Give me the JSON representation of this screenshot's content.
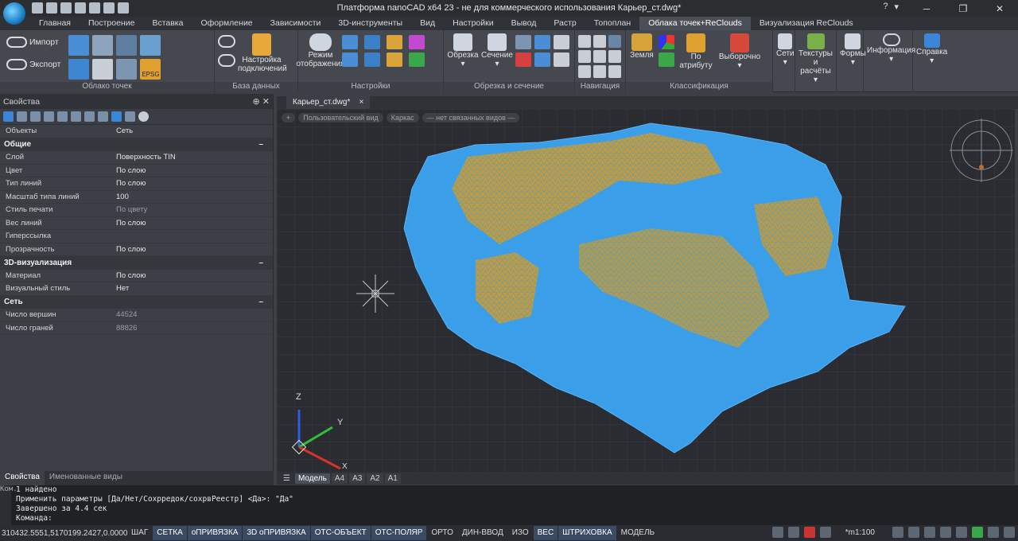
{
  "app": {
    "title": "Платформа nanoCAD x64 23 - не для коммерческого использования Карьер_ст.dwg*",
    "help": "?"
  },
  "tabs": [
    "Главная",
    "Построение",
    "Вставка",
    "Оформление",
    "Зависимости",
    "3D-инструменты",
    "Вид",
    "Настройки",
    "Вывод",
    "Растр",
    "Топоплан",
    "Облака точек+ReClouds",
    "Визуализация ReClouds"
  ],
  "active_tab": "Облака точек+ReClouds",
  "ribbon": {
    "import": "Импорт",
    "export": "Экспорт",
    "epsg": "EPSG",
    "cloud_group": "Облако точек",
    "db_group": "База данных",
    "db_settings": "Настройка подключений",
    "display_mode": "Режим отображения",
    "settings_group": "Настройки",
    "clip": "Обрезка",
    "section": "Сечение",
    "clip_group": "Обрезка и сечение",
    "nav_group": "Навигация",
    "ground": "Земля",
    "by_attr": "По атрибуту",
    "selective": "Выборочно",
    "class_group": "Классификация",
    "nets": "Сети",
    "textures": "Текстуры и расчёты",
    "forms": "Формы",
    "info": "Информация",
    "help": "Справка"
  },
  "panel": {
    "title": "Свойства",
    "rows_top": [
      {
        "k": "Объекты",
        "v": "Сеть"
      }
    ],
    "sec_general": "Общие",
    "general": [
      {
        "k": "Слой",
        "v": "Поверхность TIN"
      },
      {
        "k": "Цвет",
        "v": "По слою"
      },
      {
        "k": "Тип линий",
        "v": "По слою"
      },
      {
        "k": "Масштаб типа линий",
        "v": "100"
      },
      {
        "k": "Стиль печати",
        "v": "По цвету"
      },
      {
        "k": "Вес линий",
        "v": "По слою"
      },
      {
        "k": "Гиперссылка",
        "v": ""
      },
      {
        "k": "Прозрачность",
        "v": "По слою"
      }
    ],
    "sec_3d": "3D-визуализация",
    "vis": [
      {
        "k": "Материал",
        "v": "По слою"
      },
      {
        "k": "Визуальный стиль",
        "v": "Нет"
      }
    ],
    "sec_mesh": "Сеть",
    "mesh": [
      {
        "k": "Число вершин",
        "v": "44524"
      },
      {
        "k": "Число граней",
        "v": "88826"
      }
    ],
    "bottom_tabs": [
      "Свойства",
      "Именованные виды"
    ]
  },
  "doc": {
    "tab": "Карьер_ст.dwg*",
    "close": "×"
  },
  "viewport": {
    "bar": [
      "+",
      "Пользовательский вид",
      "Каркас",
      "— нет связанных видов —"
    ],
    "axis_x": "X",
    "axis_y": "Y",
    "axis_z": "Z"
  },
  "layouts": [
    "Модель",
    "A4",
    "A3",
    "A2",
    "A1"
  ],
  "cmd": {
    "side": "Ком.",
    "lines": [
      "1 найдено",
      "Применить параметры [Да/Нет/Сохрредок/сохрвРеестр] <Да>: \"Да\"",
      "Завершено за 4.4 сек",
      "Команда:"
    ]
  },
  "status": {
    "coords": "310432.5551,5170199.2427,0.0000",
    "buttons": [
      {
        "t": "ШАГ",
        "on": false
      },
      {
        "t": "СЕТКА",
        "on": true
      },
      {
        "t": "оПРИВЯЗКА",
        "on": true
      },
      {
        "t": "3D оПРИВЯЗКА",
        "on": true
      },
      {
        "t": "ОТС-ОБЪЕКТ",
        "on": true
      },
      {
        "t": "ОТС-ПОЛЯР",
        "on": true
      },
      {
        "t": "ОРТО",
        "on": false
      },
      {
        "t": "ДИН-ВВОД",
        "on": false
      },
      {
        "t": "ИЗО",
        "on": false
      },
      {
        "t": "ВЕС",
        "on": true
      },
      {
        "t": "ШТРИХОВКА",
        "on": true
      },
      {
        "t": "МОДЕЛЬ",
        "on": false
      }
    ],
    "scale": "*m1:100"
  },
  "colors": {
    "mesh": "#3a9ee8",
    "fill": "#d99a1f",
    "accent": "#2f7bd6"
  }
}
